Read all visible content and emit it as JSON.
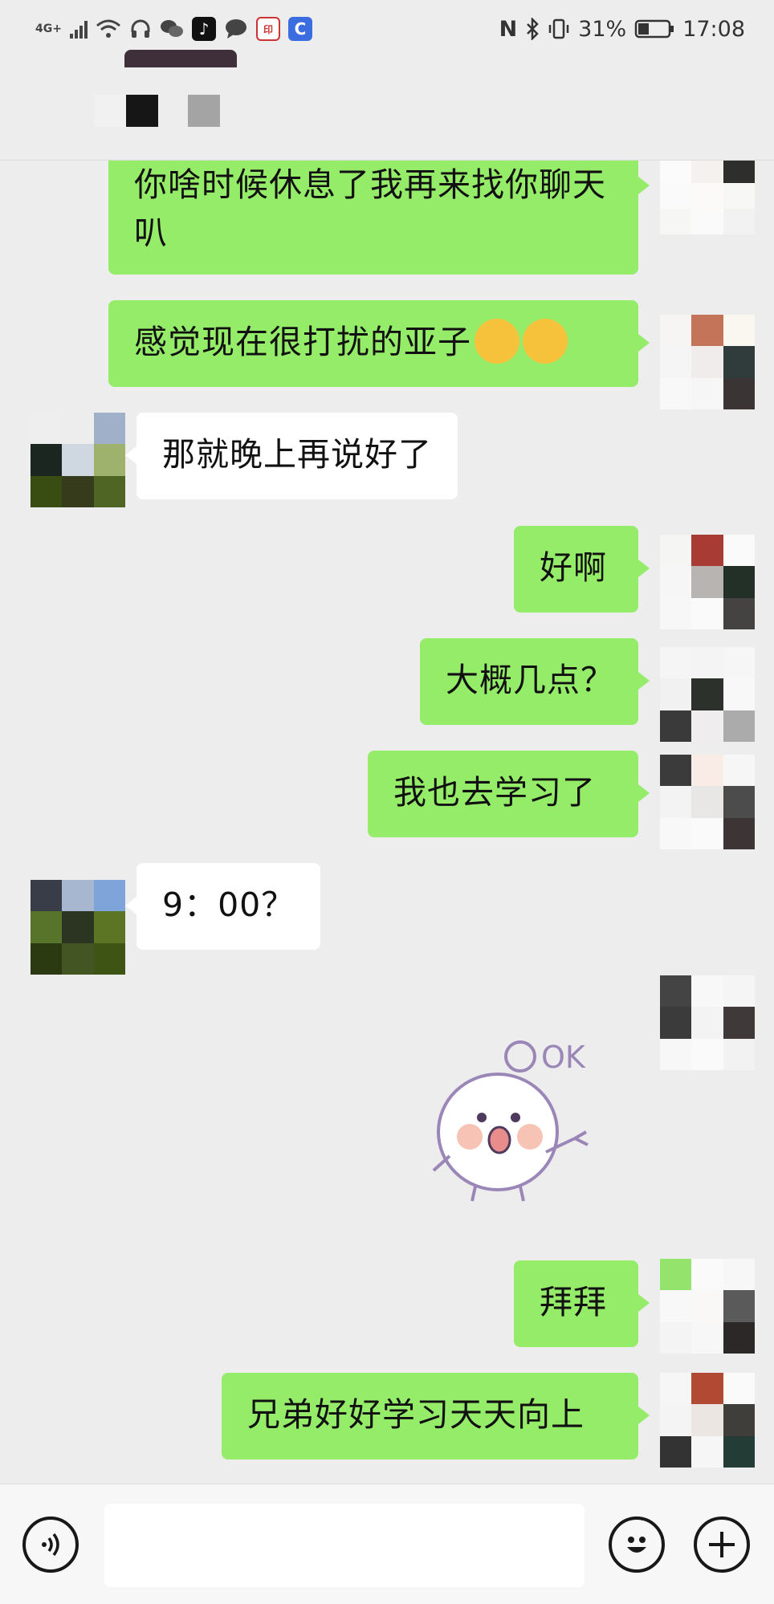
{
  "status_bar": {
    "network": "4G+",
    "battery_percent": "31%",
    "time": "17:08",
    "icons": [
      "signal-icon",
      "wifi-icon",
      "headset-icon",
      "wechat-icon",
      "tiktok-icon",
      "message-icon",
      "seal-app-icon",
      "c-app-icon",
      "nfc-icon",
      "bluetooth-icon",
      "vibrate-icon",
      "battery-icon"
    ]
  },
  "messages": [
    {
      "sender": "me",
      "text": "你啥时候休息了我再来找你聊天叭"
    },
    {
      "sender": "me",
      "text": "感觉现在很打扰的亚子",
      "emoji": "rolling-laughing-emoji"
    },
    {
      "sender": "them",
      "text": "那就晚上再说好了"
    },
    {
      "sender": "me",
      "text": "好啊"
    },
    {
      "sender": "me",
      "text": "大概几点？"
    },
    {
      "sender": "me",
      "text": "我也去学习了"
    },
    {
      "sender": "them",
      "text": "9：00？"
    },
    {
      "sender": "me",
      "sticker": "ok-sticker",
      "sticker_text": "OK"
    },
    {
      "sender": "me",
      "text": "拜拜"
    },
    {
      "sender": "me",
      "text": "兄弟好好学习天天向上"
    }
  ],
  "input_bar": {
    "icons": [
      "voice-icon",
      "emoji-icon",
      "plus-icon"
    ],
    "value": ""
  },
  "colors": {
    "background": "#ededed",
    "my_bubble": "#95ec69",
    "their_bubble": "#ffffff"
  }
}
